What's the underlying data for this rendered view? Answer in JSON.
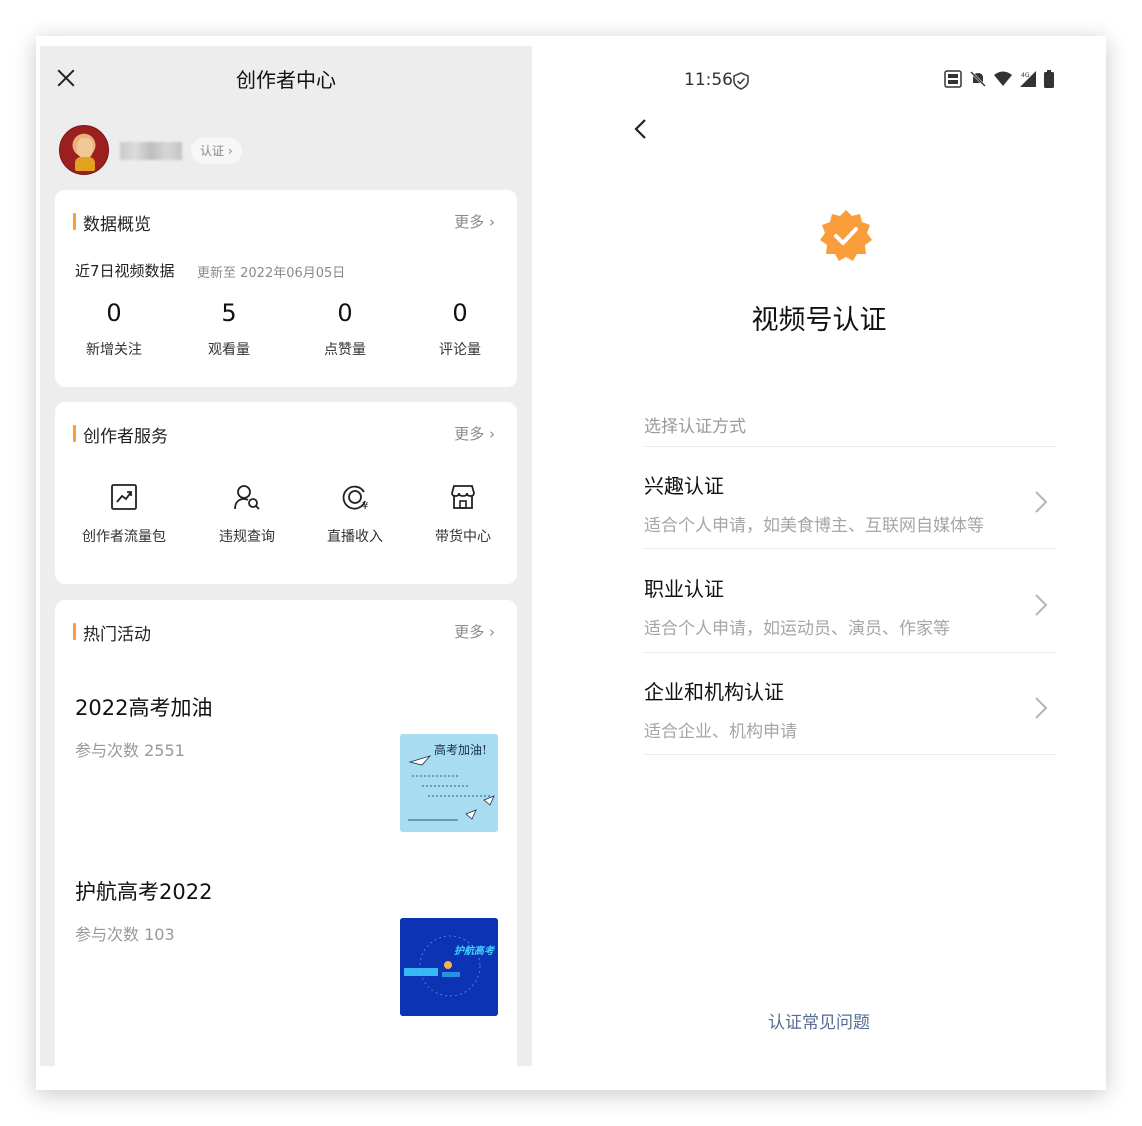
{
  "left": {
    "header": {
      "title": "创作者中心"
    },
    "profile": {
      "verify_label": "认证 ›"
    },
    "overview": {
      "heading": "数据概览",
      "more": "更多 ›",
      "period_label": "近7日视频数据",
      "updated": "更新至 2022年06月05日",
      "stats": [
        {
          "value": "0",
          "label": "新增关注"
        },
        {
          "value": "5",
          "label": "观看量"
        },
        {
          "value": "0",
          "label": "点赞量"
        },
        {
          "value": "0",
          "label": "评论量"
        }
      ]
    },
    "services": {
      "heading": "创作者服务",
      "more": "更多 ›",
      "items": [
        {
          "label": "创作者流量包",
          "icon": "trend-chart-icon"
        },
        {
          "label": "违规查询",
          "icon": "user-search-icon"
        },
        {
          "label": "直播收入",
          "icon": "live-income-icon"
        },
        {
          "label": "带货中心",
          "icon": "shop-icon"
        }
      ]
    },
    "activities": {
      "heading": "热门活动",
      "more": "更多 ›",
      "items": [
        {
          "title": "2022高考加油",
          "count": "参与次数  2551",
          "thumb_text": "高考加油!"
        },
        {
          "title": "护航高考2022",
          "count": "参与次数  103",
          "thumb_text": "护航高考"
        }
      ]
    }
  },
  "right": {
    "status": {
      "time": "11:56"
    },
    "title": "视频号认证",
    "section_label": "选择认证方式",
    "options": [
      {
        "title": "兴趣认证",
        "desc": "适合个人申请，如美食博主、互联网自媒体等"
      },
      {
        "title": "职业认证",
        "desc": "适合个人申请，如运动员、演员、作家等"
      },
      {
        "title": "企业和机构认证",
        "desc": "适合企业、机构申请"
      }
    ],
    "faq": "认证常见问题"
  },
  "colors": {
    "accent": "#fa9d3b",
    "link": "#576b95",
    "panel_bg": "#ededed"
  }
}
